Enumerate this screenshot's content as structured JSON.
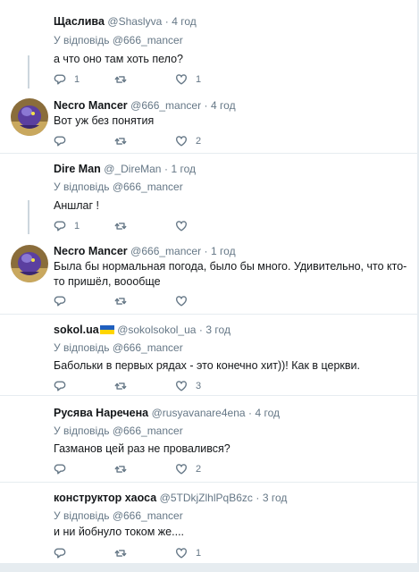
{
  "icons": {
    "reply": "reply-icon",
    "retweet": "retweet-icon",
    "like": "heart-icon"
  },
  "colors": {
    "muted": "#657786",
    "border": "#e6ecf0",
    "flag_blue": "#1f5fbf",
    "flag_yellow": "#ffd500"
  },
  "tweets": [
    {
      "name": "Щаслива",
      "handle": "@Shaslyva",
      "dot": "·",
      "time": "4 год",
      "reply_prefix": "У відповідь",
      "reply_to": "@666_mancer",
      "text": "а что оно там хоть пело?",
      "replies": "1",
      "retweets": "",
      "likes": "1"
    },
    {
      "name": "Necro Mancer",
      "handle": "@666_mancer",
      "dot": "·",
      "time": "4 год",
      "text": "Вот уж без понятия",
      "replies": "",
      "retweets": "",
      "likes": "2"
    },
    {
      "name": "Dire Man",
      "handle": "@_DireMan",
      "dot": "·",
      "time": "1 год",
      "reply_prefix": "У відповідь",
      "reply_to": "@666_mancer",
      "text": "Аншлаг !",
      "replies": "1",
      "retweets": "",
      "likes": ""
    },
    {
      "name": "Necro Mancer",
      "handle": "@666_mancer",
      "dot": "·",
      "time": "1 год",
      "text": "Была бы нормальная погода, было бы много. Удивительно, что кто-то пришёл, воообще",
      "replies": "",
      "retweets": "",
      "likes": ""
    },
    {
      "name": "sokol.ua",
      "handle": "@sokolsokol_ua",
      "dot": "·",
      "time": "3 год",
      "reply_prefix": "У відповідь",
      "reply_to": "@666_mancer",
      "text": "Бабольки в первых рядах - это конечно хит))! Как в церкви.",
      "replies": "",
      "retweets": "",
      "likes": "3"
    },
    {
      "name": "Русява Наречена",
      "handle": "@rusyavanare4ena",
      "dot": "·",
      "time": "4 год",
      "reply_prefix": "У відповідь",
      "reply_to": "@666_mancer",
      "text": "Газманов цей раз не провалився?",
      "replies": "",
      "retweets": "",
      "likes": "2"
    },
    {
      "name": "конструктор хаоса",
      "handle": "@5TDkjZlhlPqB6zc",
      "dot": "·",
      "time": "3 год",
      "reply_prefix": "У відповідь",
      "reply_to": "@666_mancer",
      "text": "и ни йобнуло током же....",
      "replies": "",
      "retweets": "",
      "likes": "1"
    }
  ]
}
